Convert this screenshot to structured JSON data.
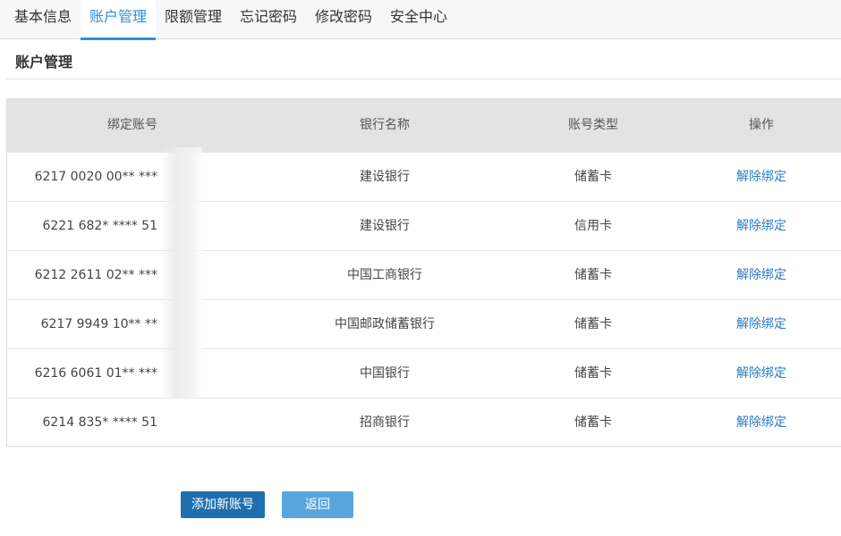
{
  "tabs": [
    {
      "label": "基本信息"
    },
    {
      "label": "账户管理"
    },
    {
      "label": "限额管理"
    },
    {
      "label": "忘记密码"
    },
    {
      "label": "修改密码"
    },
    {
      "label": "安全中心"
    }
  ],
  "active_tab": "账户管理",
  "section_title": "账户管理",
  "table": {
    "headers": [
      "绑定账号",
      "银行名称",
      "账号类型",
      "操作"
    ],
    "rows": [
      {
        "account": "6217 0020 00** ***",
        "bank": "建设银行",
        "type": "储蓄卡",
        "action": "解除绑定"
      },
      {
        "account": "6221 682* **** 51",
        "bank": "建设银行",
        "type": "信用卡",
        "action": "解除绑定"
      },
      {
        "account": "6212 2611 02** ***",
        "bank": "中国工商银行",
        "type": "储蓄卡",
        "action": "解除绑定"
      },
      {
        "account": "6217 9949 10** **",
        "bank": "中国邮政储蓄银行",
        "type": "储蓄卡",
        "action": "解除绑定"
      },
      {
        "account": "6216 6061 01** ***",
        "bank": "中国银行",
        "type": "储蓄卡",
        "action": "解除绑定"
      },
      {
        "account": "6214 835* **** 51",
        "bank": "招商银行",
        "type": "储蓄卡",
        "action": "解除绑定"
      }
    ]
  },
  "buttons": {
    "add": "添加新账号",
    "back": "返回"
  },
  "colors": {
    "accent": "#2f8fd8",
    "link": "#2b7bc4",
    "primary_button": "#1f6fae",
    "secondary_button": "#5aa6dc",
    "header_bg": "#e3e3e3"
  }
}
